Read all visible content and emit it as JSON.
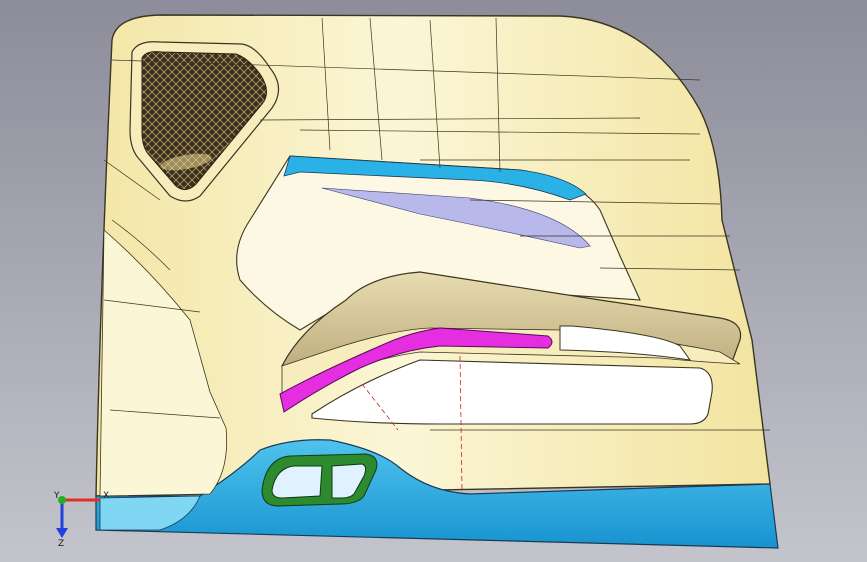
{
  "viewport": {
    "background_top": "#8c8c9a",
    "background_bottom": "#c4c4cc"
  },
  "model": {
    "name": "door-trim-panel",
    "colors": {
      "panel_face": "#f5ecb0",
      "panel_highlight": "#fbf6d6",
      "panel_edge": "#3a3520",
      "lower_band": "#1ea6de",
      "lower_band_light": "#4fc3ee",
      "armrest_accent": "#e42ee0",
      "armrest_top": "#c8b88a",
      "pocket_surface": "#ffffff",
      "speaker_mesh": "#3b3020",
      "window_glass": "#b8b8ea",
      "handle_ring": "#2e8a2e",
      "handle_ring_light": "#7fd07f"
    }
  },
  "triad": {
    "x_label": "X",
    "y_label": "Y",
    "z_label": "Z",
    "x_color": "#e03020",
    "y_color": "#20b020",
    "z_color": "#2040e0"
  }
}
